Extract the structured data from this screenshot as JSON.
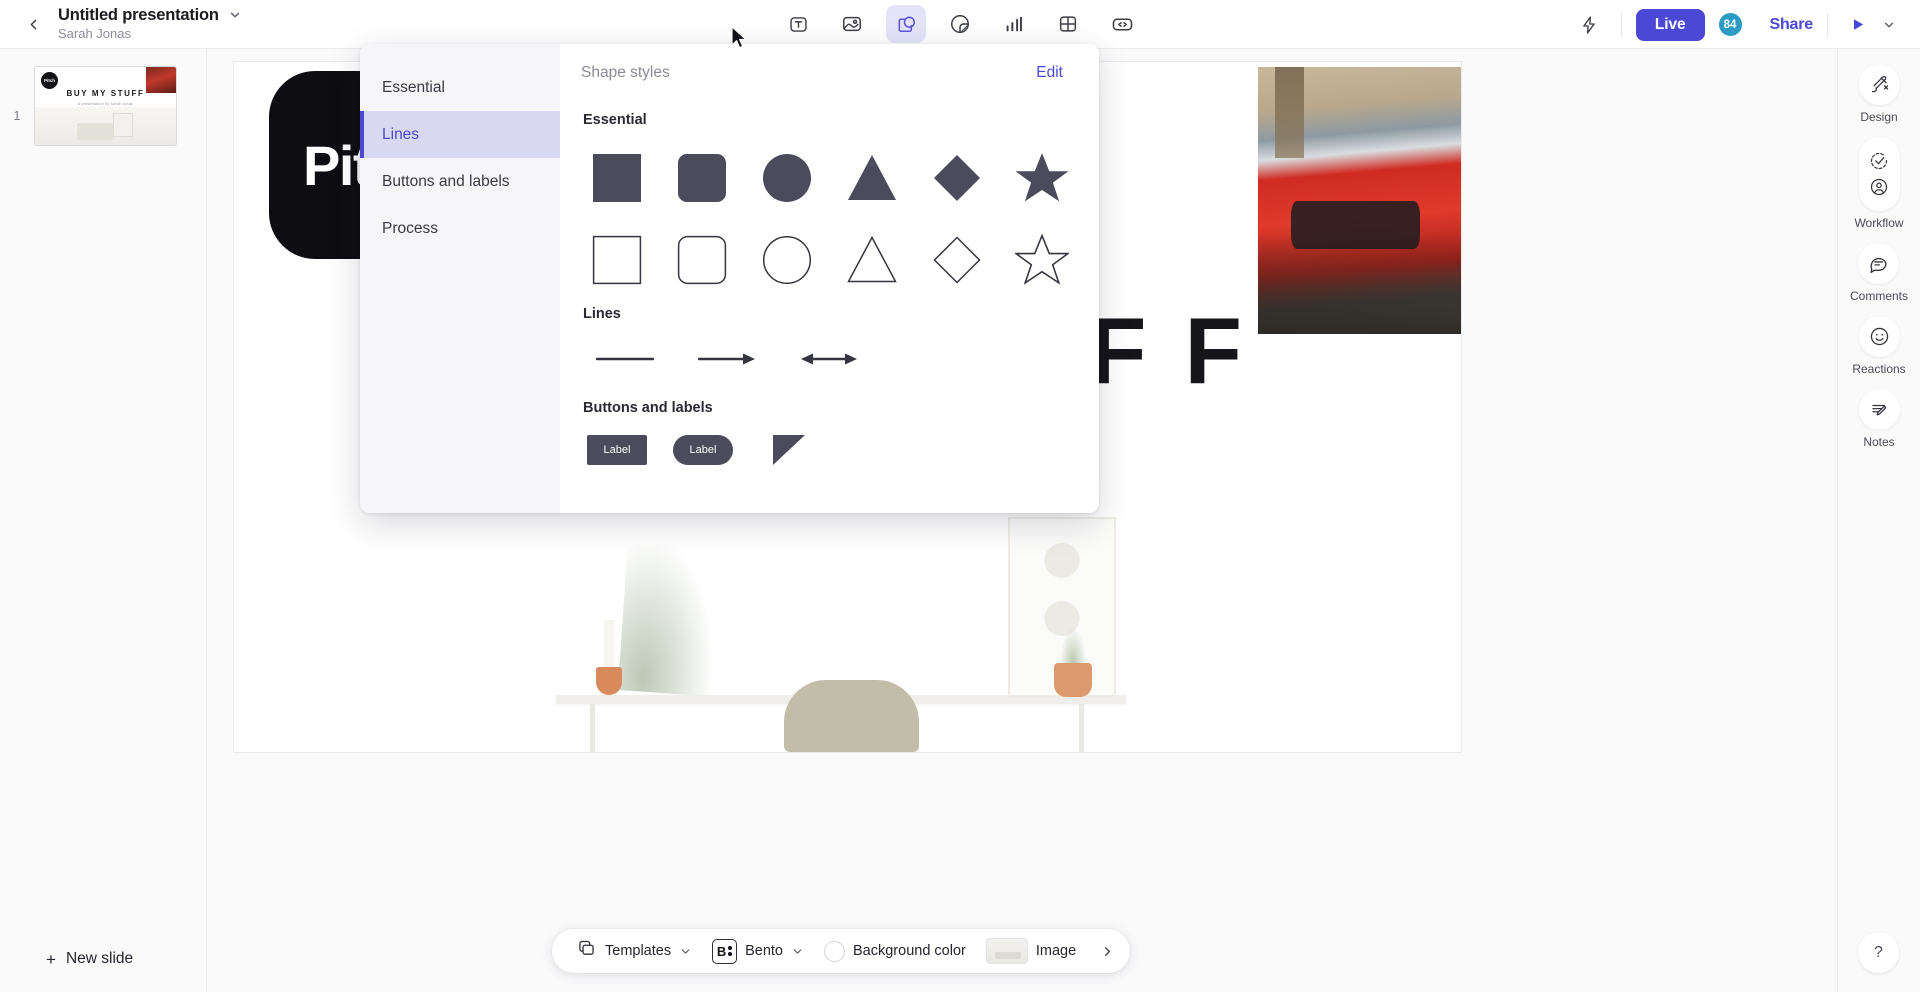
{
  "header": {
    "back_label": "back",
    "doc_title": "Untitled presentation",
    "doc_author": "Sarah Jonas",
    "tools": [
      {
        "name": "text-tool",
        "icon": "text-box-icon",
        "active": false
      },
      {
        "name": "image-tool",
        "icon": "image-icon",
        "active": false
      },
      {
        "name": "shape-tool",
        "icon": "shapes-icon",
        "active": true
      },
      {
        "name": "sticker-tool",
        "icon": "sticker-icon",
        "active": false
      },
      {
        "name": "chart-tool",
        "icon": "bar-chart-icon",
        "active": false
      },
      {
        "name": "table-tool",
        "icon": "table-icon",
        "active": false
      },
      {
        "name": "embed-tool",
        "icon": "code-embed-icon",
        "active": false
      }
    ],
    "bolt_icon": "lightning-bolt-icon",
    "live_label": "Live",
    "avatar_count": "84",
    "share_label": "Share",
    "present_icon": "play-icon",
    "present_caret_icon": "chevron-down-icon"
  },
  "slides": {
    "items": [
      {
        "number": "1",
        "logo_text": "Pitch",
        "title": "BUY MY STUFF",
        "subtitle": "A presentation by Sarah Jonas"
      }
    ],
    "new_slide_label": "New slide",
    "new_slide_icon": "plus-icon"
  },
  "canvas": {
    "badge_text": "Pitch",
    "headline": "F F",
    "connector_icon": "arrow-right-icon"
  },
  "shape_picker": {
    "categories": [
      {
        "label": "Essential",
        "active": false
      },
      {
        "label": "Lines",
        "active": true
      },
      {
        "label": "Buttons and labels",
        "active": false
      },
      {
        "label": "Process",
        "active": false
      }
    ],
    "panel_title": "Shape styles",
    "edit_label": "Edit",
    "sections": [
      {
        "title": "Essential",
        "rows": [
          [
            "square-filled",
            "rounded-square-filled",
            "circle-filled",
            "triangle-filled",
            "diamond-filled",
            "star-filled"
          ],
          [
            "square-outline",
            "rounded-square-outline",
            "circle-outline",
            "triangle-outline",
            "diamond-outline",
            "star-outline"
          ]
        ]
      },
      {
        "title": "Lines",
        "items": [
          "line-plain",
          "line-arrow-right",
          "line-arrow-double"
        ]
      },
      {
        "title": "Buttons and labels",
        "items": [
          "button-square",
          "button-rounded",
          "ribbon-label"
        ],
        "button_label": "Label"
      }
    ]
  },
  "right_rail": {
    "items": [
      {
        "label": "Design",
        "icon": "brush-icon"
      },
      {
        "label": "Workflow",
        "icon": "check-circle-icon"
      },
      {
        "label": "Comments",
        "icon": "comment-bubble-icon"
      },
      {
        "label": "Reactions",
        "icon": "smiley-icon"
      },
      {
        "label": "Notes",
        "icon": "notes-pencil-icon"
      }
    ],
    "help_label": "?"
  },
  "bottom_bar": {
    "templates_label": "Templates",
    "templates_icon": "stacked-shapes-icon",
    "theme_label": "Bento",
    "theme_icon": "bento-brand-icon",
    "background_label": "Background color",
    "background_swatch_color": "#ffffff",
    "image_label": "Image",
    "more_icon": "chevron-right-icon"
  },
  "colors": {
    "accent": "#4b48d6",
    "accent_soft": "#d9d8f2",
    "shape_fill": "#4b4b5c",
    "avatar": "#2d9cc4"
  }
}
